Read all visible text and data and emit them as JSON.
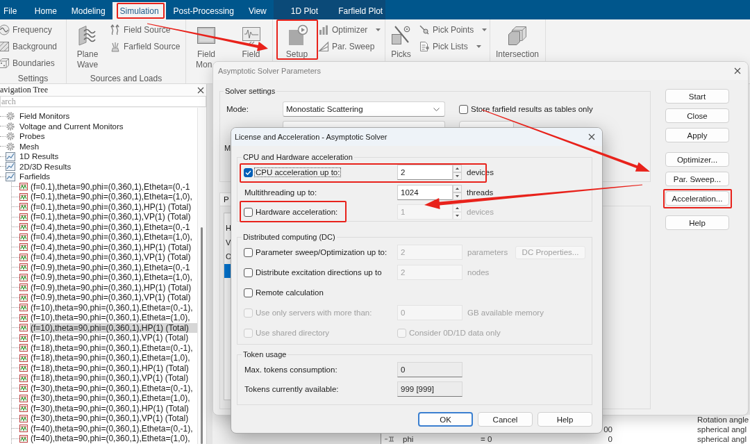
{
  "menu_bar": {
    "tabs": [
      {
        "label": "File",
        "selected": false
      },
      {
        "label": "Home",
        "selected": false
      },
      {
        "label": "Modeling",
        "selected": false
      },
      {
        "label": "Simulation",
        "selected": true
      },
      {
        "label": "Post-Processing",
        "selected": false
      },
      {
        "label": "View",
        "selected": false
      }
    ],
    "context_tabs": [
      {
        "label": "1D Plot",
        "selected": false
      },
      {
        "label": "Farfield Plot",
        "selected": false
      }
    ]
  },
  "ribbon": {
    "groups": [
      {
        "label": "Settings",
        "items": [
          {
            "kind": "small",
            "label": "Frequency",
            "dropdown": false
          },
          {
            "kind": "small",
            "label": "Background",
            "dropdown": false
          },
          {
            "kind": "small",
            "label": "Boundaries",
            "dropdown": false
          }
        ]
      },
      {
        "label": "Sources and Loads",
        "items": [
          {
            "kind": "large",
            "lines": [
              "Plane",
              "Wave"
            ]
          },
          {
            "kind": "small",
            "label": "Field Source",
            "dropdown": false
          },
          {
            "kind": "small",
            "label": "Farfield Source",
            "dropdown": false
          }
        ]
      },
      {
        "items": [
          {
            "kind": "large",
            "lines": [
              "Field",
              "Mon"
            ]
          },
          {
            "kind": "large",
            "lines": [
              "Field"
            ]
          }
        ]
      },
      {
        "items": [
          {
            "kind": "large",
            "lines": [
              "Setup"
            ]
          },
          {
            "kind": "small",
            "label": "Optimizer",
            "dropdown": true
          },
          {
            "kind": "small",
            "label": "Par. Sweep",
            "dropdown": false
          }
        ]
      },
      {
        "items": [
          {
            "kind": "large",
            "lines": [
              "Picks"
            ]
          },
          {
            "kind": "small",
            "label": "Pick Points",
            "dropdown": true
          },
          {
            "kind": "small",
            "label": "Pick Lists",
            "dropdown": true
          }
        ]
      },
      {
        "items": [
          {
            "kind": "large",
            "lines": [
              "Intersection"
            ]
          }
        ]
      }
    ]
  },
  "navigation_tree": {
    "title": "avigation Tree",
    "search": {
      "placeholder": "arch"
    },
    "items": [
      {
        "label": "Field Monitors",
        "kind": "monitor",
        "selected": false
      },
      {
        "label": "Voltage and Current Monitors",
        "kind": "monitor",
        "selected": false
      },
      {
        "label": "Probes",
        "kind": "monitor",
        "selected": false
      },
      {
        "label": "Mesh",
        "kind": "monitor",
        "selected": false
      },
      {
        "label": "1D Results",
        "kind": "result",
        "selected": false
      },
      {
        "label": "2D/3D Results",
        "kind": "result",
        "selected": false
      },
      {
        "label": "Farfields",
        "kind": "result",
        "selected": false,
        "children": [
          {
            "label": "(f=0.1),theta=90,phi=(0,360,1),Etheta=(0,-1",
            "kind": "farfield",
            "selected": false
          },
          {
            "label": "(f=0.1),theta=90,phi=(0,360,1),Etheta=(1,0),",
            "kind": "farfield",
            "selected": false
          },
          {
            "label": "(f=0.1),theta=90,phi=(0,360,1),HP(1) (Total)",
            "kind": "farfield",
            "selected": false
          },
          {
            "label": "(f=0.1),theta=90,phi=(0,360,1),VP(1) (Total)",
            "kind": "farfield",
            "selected": false
          },
          {
            "label": "(f=0.4),theta=90,phi=(0,360,1),Etheta=(0,-1",
            "kind": "farfield",
            "selected": false
          },
          {
            "label": "(f=0.4),theta=90,phi=(0,360,1),Etheta=(1,0),",
            "kind": "farfield",
            "selected": false
          },
          {
            "label": "(f=0.4),theta=90,phi=(0,360,1),HP(1) (Total)",
            "kind": "farfield",
            "selected": false
          },
          {
            "label": "(f=0.4),theta=90,phi=(0,360,1),VP(1) (Total)",
            "kind": "farfield",
            "selected": false
          },
          {
            "label": "(f=0.9),theta=90,phi=(0,360,1),Etheta=(0,-1",
            "kind": "farfield",
            "selected": false
          },
          {
            "label": "(f=0.9),theta=90,phi=(0,360,1),Etheta=(1,0),",
            "kind": "farfield",
            "selected": false
          },
          {
            "label": "(f=0.9),theta=90,phi=(0,360,1),HP(1) (Total)",
            "kind": "farfield",
            "selected": false
          },
          {
            "label": "(f=0.9),theta=90,phi=(0,360,1),VP(1) (Total)",
            "kind": "farfield",
            "selected": false
          },
          {
            "label": "(f=10),theta=90,phi=(0,360,1),Etheta=(0,-1),",
            "kind": "farfield",
            "selected": false
          },
          {
            "label": "(f=10),theta=90,phi=(0,360,1),Etheta=(1,0),",
            "kind": "farfield",
            "selected": false
          },
          {
            "label": "(f=10),theta=90,phi=(0,360,1),HP(1) (Total)",
            "kind": "farfield",
            "selected": true
          },
          {
            "label": "(f=10),theta=90,phi=(0,360,1),VP(1) (Total)",
            "kind": "farfield",
            "selected": false
          },
          {
            "label": "(f=18),theta=90,phi=(0,360,1),Etheta=(0,-1),",
            "kind": "farfield",
            "selected": false
          },
          {
            "label": "(f=18),theta=90,phi=(0,360,1),Etheta=(1,0),",
            "kind": "farfield",
            "selected": false
          },
          {
            "label": "(f=18),theta=90,phi=(0,360,1),HP(1) (Total)",
            "kind": "farfield",
            "selected": false
          },
          {
            "label": "(f=18),theta=90,phi=(0,360,1),VP(1) (Total)",
            "kind": "farfield",
            "selected": false
          },
          {
            "label": "(f=30),theta=90,phi=(0,360,1),Etheta=(0,-1),",
            "kind": "farfield",
            "selected": false
          },
          {
            "label": "(f=30),theta=90,phi=(0,360,1),Etheta=(1,0),",
            "kind": "farfield",
            "selected": false
          },
          {
            "label": "(f=30),theta=90,phi=(0,360,1),HP(1) (Total)",
            "kind": "farfield",
            "selected": false
          },
          {
            "label": "(f=30),theta=90,phi=(0,360,1),VP(1) (Total)",
            "kind": "farfield",
            "selected": false
          },
          {
            "label": "(f=40),theta=90,phi=(0,360,1),Etheta=(0,-1),",
            "kind": "farfield",
            "selected": false
          },
          {
            "label": "(f=40),theta=90,phi=(0,360,1),Etheta=(1,0),",
            "kind": "farfield",
            "selected": false
          }
        ]
      }
    ]
  },
  "solver_dialog": {
    "title": "Asymptotic Solver Parameters",
    "solver_settings": {
      "label": "Solver settings",
      "mode": {
        "label": "Mode:",
        "value": "Monostatic Scattering"
      },
      "store_tables": {
        "label": "Store farfield results as tables only",
        "checked": false
      },
      "row_3_label": "M"
    },
    "tab": {
      "label": "P",
      "list": [
        {
          "label": "H",
          "selected": false
        },
        {
          "label": "V",
          "selected": false
        },
        {
          "label": "O",
          "selected": false
        },
        {
          "selected": true
        }
      ]
    },
    "button_groups": [
      [
        {
          "label": "Start"
        },
        {
          "label": "Close"
        },
        {
          "label": "Apply"
        }
      ],
      [
        {
          "label": "Optimizer..."
        },
        {
          "label": "Par. Sweep..."
        },
        {
          "label": "Acceleration..."
        }
      ],
      [
        {
          "label": "Help"
        }
      ]
    ]
  },
  "license_dialog": {
    "title": "License and Acceleration - Asymptotic Solver",
    "groups": [
      {
        "label": "CPU and Hardware acceleration",
        "rows": [
          {
            "kind": "check",
            "label": "CPU acceleration up to:",
            "checked": true,
            "disabled": false,
            "focused": true,
            "field": {
              "kind": "spin",
              "value": "2",
              "disabled": false
            },
            "unit": "devices"
          },
          {
            "kind": "text",
            "label": "Multithreading up to:",
            "field": {
              "kind": "spin",
              "value": "1024",
              "disabled": false
            },
            "unit": "threads"
          },
          {
            "kind": "check",
            "label": "Hardware acceleration:",
            "checked": false,
            "disabled": false,
            "focused": false,
            "field": {
              "kind": "spin",
              "value": "1",
              "disabled": true
            },
            "unit": "devices"
          }
        ]
      },
      {
        "label": "Distributed computing (DC)",
        "rows": [
          {
            "kind": "check",
            "label": "Parameter sweep/Optimization up to:",
            "checked": false,
            "disabled": false,
            "focused": false,
            "field": {
              "kind": "text",
              "value": "2",
              "disabled": true
            },
            "unit": "parameters",
            "button": {
              "label": "DC Properties...",
              "disabled": true
            }
          },
          {
            "kind": "check",
            "label": "Distribute excitation directions up to",
            "checked": false,
            "disabled": false,
            "focused": false,
            "field": {
              "kind": "text",
              "value": "2",
              "disabled": true
            },
            "unit": "nodes"
          },
          {
            "kind": "check",
            "label": "Remote calculation",
            "checked": false,
            "disabled": false,
            "focused": false
          },
          {
            "kind": "check",
            "label": "Use only servers with more than:",
            "checked": false,
            "disabled": true,
            "focused": false,
            "field": {
              "kind": "text",
              "value": "0",
              "disabled": true
            },
            "unit": "GB available memory"
          },
          {
            "kind": "check",
            "label": "Use shared directory",
            "checked": false,
            "disabled": true,
            "focused": false,
            "option": {
              "label": "Consider 0D/1D data only",
              "checked": false,
              "disabled": true
            }
          }
        ]
      },
      {
        "label": "Token usage",
        "rows": [
          {
            "kind": "text",
            "label": "Max. tokens consumption:",
            "field": {
              "kind": "readonly",
              "value": "0",
              "disabled": false
            }
          },
          {
            "kind": "text",
            "label": "Tokens currently available:",
            "field": {
              "kind": "readonly",
              "value": "999 [999]",
              "disabled": false
            }
          }
        ]
      }
    ],
    "buttons": [
      {
        "label": "OK",
        "default": true
      },
      {
        "label": "Cancel",
        "default": false
      },
      {
        "label": "Help",
        "default": false
      }
    ]
  },
  "parameter_list": {
    "rows": [
      {
        "description": "Rotation angle"
      },
      {
        "value": "00",
        "description": "spherical angl"
      },
      {
        "name": "phi",
        "expression": "= 0",
        "value": "0",
        "description": "spherical angl"
      }
    ]
  }
}
